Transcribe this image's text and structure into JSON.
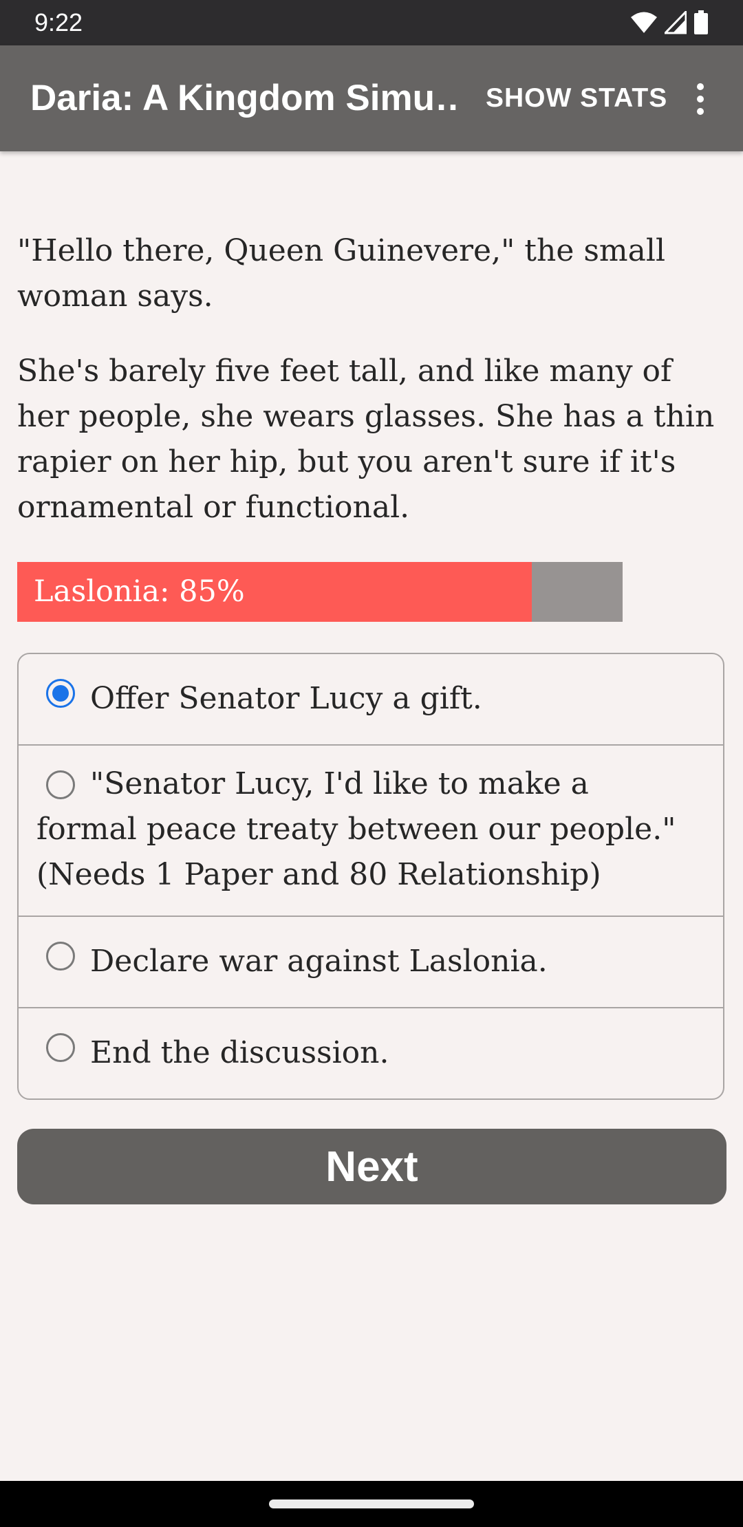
{
  "status_bar": {
    "time": "9:22"
  },
  "app_bar": {
    "title": "Daria: A Kingdom Simu…",
    "show_stats_label": "SHOW STATS"
  },
  "story": {
    "paragraph_1": "\"Hello there, Queen Guinevere,\" the small woman says.",
    "paragraph_2": "She's barely five feet tall, and like many of her people, she wears glasses. She has a thin rapier on her hip, but you aren't sure if it's ornamental or functional."
  },
  "relationship": {
    "label": "Laslonia: 85%",
    "percent": 85,
    "fill_color": "#fe5a55",
    "track_color": "#979392"
  },
  "choices": [
    {
      "label": "Offer Senator Lucy a gift.",
      "selected": true
    },
    {
      "label": "\"Senator Lucy, I'd like to make a formal peace treaty between our people.\" (Needs 1 Paper and 80 Relationship)",
      "selected": false
    },
    {
      "label": "Declare war against Laslonia.",
      "selected": false
    },
    {
      "label": "End the discussion.",
      "selected": false
    }
  ],
  "next_button": {
    "label": "Next"
  },
  "colors": {
    "app_bar": "#666463",
    "status_bar": "#2d2c2e",
    "background": "#f7f2f1",
    "radio_selected": "#1a73e8",
    "button": "#63615f"
  },
  "icons": {
    "status": [
      "wifi-icon",
      "signal-icon",
      "battery-icon"
    ],
    "menu": "more-vert-icon"
  }
}
